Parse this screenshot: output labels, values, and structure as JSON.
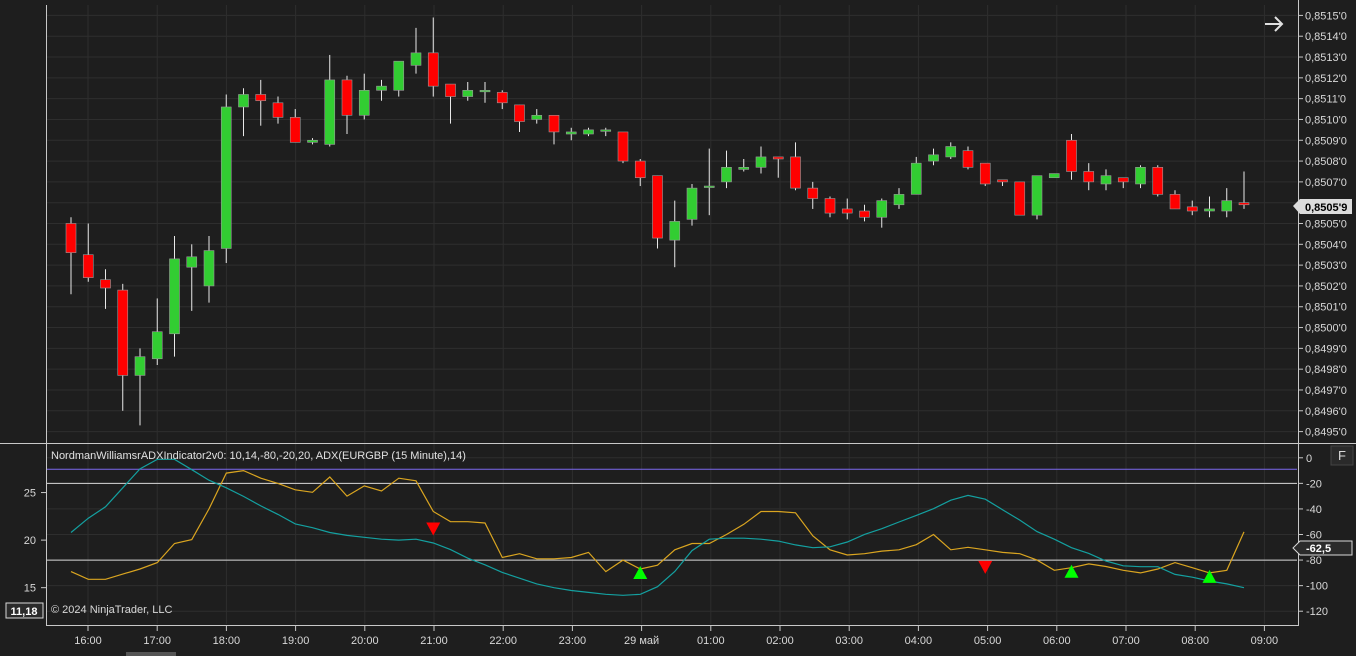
{
  "colors": {
    "background": "#1e1e1e",
    "grid": "#2e2e2e",
    "separator": "#c8c8c8",
    "up_candle": "#32cd32",
    "down_candle": "#ff0000",
    "wick": "#e8e8e8",
    "williams_line": "#daa520",
    "adx_line": "#14a0a0",
    "buy_arrow": "#00ff00",
    "sell_arrow": "#ff0000",
    "upper_level_line": "#7b68ee",
    "level_line": "#d8d8d8"
  },
  "icons": {
    "scroll_right": "arrow-right-icon",
    "panel_toggle": "F"
  },
  "indicator_title": "NordmanWilliamsrADXIndicator2v0: 10,14,-80,-20,20, ADX(EURGBP (15 Minute),14)",
  "copyright": "© 2024 NinjaTrader, LLC",
  "chart_data": [
    {
      "type": "candlestick",
      "instrument": "EURGBP (15 Minute)",
      "price_label": "0,8505'9",
      "price_tick_labels": [
        "0,8515'0",
        "0,8514'0",
        "0,8513'0",
        "0,8512'0",
        "0,8511'0",
        "0,8510'0",
        "0,8509'0",
        "0,8508'0",
        "0,8507'0",
        "0,8506'0",
        "0,8505'0",
        "0,8504'0",
        "0,8503'0",
        "0,8502'0",
        "0,8501'0",
        "0,8500'0",
        "0,8499'0",
        "0,8498'0",
        "0,8497'0",
        "0,8496'0",
        "0,8495'0"
      ],
      "y_range": [
        0.84945,
        0.85155
      ],
      "x_labels": [
        "16:00",
        "17:00",
        "18:00",
        "19:00",
        "20:00",
        "21:00",
        "22:00",
        "23:00",
        "29 май",
        "01:00",
        "02:00",
        "03:00",
        "04:00",
        "05:00",
        "06:00",
        "07:00",
        "08:00",
        "09:00"
      ],
      "candles": [
        {
          "o": 0.8505,
          "h": 0.85053,
          "l": 0.85016,
          "c": 0.85036
        },
        {
          "o": 0.85035,
          "h": 0.8505,
          "l": 0.85022,
          "c": 0.85024
        },
        {
          "o": 0.85023,
          "h": 0.85028,
          "l": 0.85009,
          "c": 0.85019
        },
        {
          "o": 0.85018,
          "h": 0.85021,
          "l": 0.8496,
          "c": 0.84977
        },
        {
          "o": 0.84977,
          "h": 0.8499,
          "l": 0.84953,
          "c": 0.84986
        },
        {
          "o": 0.84985,
          "h": 0.85014,
          "l": 0.84982,
          "c": 0.84998
        },
        {
          "o": 0.84997,
          "h": 0.85044,
          "l": 0.84986,
          "c": 0.85033
        },
        {
          "o": 0.85029,
          "h": 0.8504,
          "l": 0.85008,
          "c": 0.85034
        },
        {
          "o": 0.8502,
          "h": 0.85044,
          "l": 0.85012,
          "c": 0.85037
        },
        {
          "o": 0.85038,
          "h": 0.85112,
          "l": 0.85031,
          "c": 0.85106
        },
        {
          "o": 0.85106,
          "h": 0.85115,
          "l": 0.85092,
          "c": 0.85112
        },
        {
          "o": 0.85112,
          "h": 0.85119,
          "l": 0.85097,
          "c": 0.85109
        },
        {
          "o": 0.85108,
          "h": 0.85111,
          "l": 0.85098,
          "c": 0.85101
        },
        {
          "o": 0.85101,
          "h": 0.85105,
          "l": 0.85089,
          "c": 0.85089
        },
        {
          "o": 0.85089,
          "h": 0.85091,
          "l": 0.85088,
          "c": 0.8509
        },
        {
          "o": 0.85088,
          "h": 0.85131,
          "l": 0.85087,
          "c": 0.85119
        },
        {
          "o": 0.85119,
          "h": 0.85121,
          "l": 0.85093,
          "c": 0.85102
        },
        {
          "o": 0.85102,
          "h": 0.85122,
          "l": 0.851,
          "c": 0.85114
        },
        {
          "o": 0.85114,
          "h": 0.85119,
          "l": 0.85109,
          "c": 0.85116
        },
        {
          "o": 0.85114,
          "h": 0.85128,
          "l": 0.85111,
          "c": 0.85128
        },
        {
          "o": 0.85126,
          "h": 0.85144,
          "l": 0.85122,
          "c": 0.85132
        },
        {
          "o": 0.85132,
          "h": 0.85149,
          "l": 0.85111,
          "c": 0.85116
        },
        {
          "o": 0.85117,
          "h": 0.85117,
          "l": 0.85098,
          "c": 0.85111
        },
        {
          "o": 0.85111,
          "h": 0.85118,
          "l": 0.85109,
          "c": 0.85114
        },
        {
          "o": 0.85114,
          "h": 0.85118,
          "l": 0.85108,
          "c": 0.85114
        },
        {
          "o": 0.85113,
          "h": 0.85114,
          "l": 0.85105,
          "c": 0.85108
        },
        {
          "o": 0.85107,
          "h": 0.85103,
          "l": 0.85094,
          "c": 0.85099
        },
        {
          "o": 0.851,
          "h": 0.85105,
          "l": 0.85098,
          "c": 0.85102
        },
        {
          "o": 0.85102,
          "h": 0.85102,
          "l": 0.85088,
          "c": 0.85094
        },
        {
          "o": 0.85093,
          "h": 0.85096,
          "l": 0.8509,
          "c": 0.85094
        },
        {
          "o": 0.85093,
          "h": 0.85096,
          "l": 0.85092,
          "c": 0.85095
        },
        {
          "o": 0.85095,
          "h": 0.85096,
          "l": 0.85092,
          "c": 0.85095
        },
        {
          "o": 0.85094,
          "h": 0.85094,
          "l": 0.85079,
          "c": 0.8508
        },
        {
          "o": 0.8508,
          "h": 0.85081,
          "l": 0.85068,
          "c": 0.85072
        },
        {
          "o": 0.85073,
          "h": 0.85071,
          "l": 0.85038,
          "c": 0.85043
        },
        {
          "o": 0.85042,
          "h": 0.85061,
          "l": 0.85029,
          "c": 0.85051
        },
        {
          "o": 0.85052,
          "h": 0.85069,
          "l": 0.85049,
          "c": 0.85067
        },
        {
          "o": 0.85068,
          "h": 0.85086,
          "l": 0.85054,
          "c": 0.85068
        },
        {
          "o": 0.8507,
          "h": 0.85085,
          "l": 0.85067,
          "c": 0.85077
        },
        {
          "o": 0.85076,
          "h": 0.85081,
          "l": 0.85075,
          "c": 0.85077
        },
        {
          "o": 0.85077,
          "h": 0.85087,
          "l": 0.85074,
          "c": 0.85082
        },
        {
          "o": 0.85082,
          "h": 0.85082,
          "l": 0.85072,
          "c": 0.85081
        },
        {
          "o": 0.85082,
          "h": 0.85089,
          "l": 0.85066,
          "c": 0.85067
        },
        {
          "o": 0.85067,
          "h": 0.8507,
          "l": 0.85057,
          "c": 0.85062
        },
        {
          "o": 0.85062,
          "h": 0.85063,
          "l": 0.85053,
          "c": 0.85055
        },
        {
          "o": 0.85057,
          "h": 0.85062,
          "l": 0.85052,
          "c": 0.85055
        },
        {
          "o": 0.85056,
          "h": 0.85059,
          "l": 0.85051,
          "c": 0.85053
        },
        {
          "o": 0.85053,
          "h": 0.85062,
          "l": 0.85048,
          "c": 0.85061
        },
        {
          "o": 0.85059,
          "h": 0.85067,
          "l": 0.85057,
          "c": 0.85064
        },
        {
          "o": 0.85064,
          "h": 0.85082,
          "l": 0.85064,
          "c": 0.85079
        },
        {
          "o": 0.8508,
          "h": 0.85086,
          "l": 0.85078,
          "c": 0.85083
        },
        {
          "o": 0.85082,
          "h": 0.85089,
          "l": 0.85081,
          "c": 0.85087
        },
        {
          "o": 0.85085,
          "h": 0.85087,
          "l": 0.85076,
          "c": 0.85077
        },
        {
          "o": 0.85079,
          "h": 0.85078,
          "l": 0.85068,
          "c": 0.85069
        },
        {
          "o": 0.85071,
          "h": 0.8507,
          "l": 0.85068,
          "c": 0.8507
        },
        {
          "o": 0.8507,
          "h": 0.85068,
          "l": 0.85055,
          "c": 0.85054
        },
        {
          "o": 0.85054,
          "h": 0.85072,
          "l": 0.85052,
          "c": 0.85073
        },
        {
          "o": 0.85072,
          "h": 0.85074,
          "l": 0.85072,
          "c": 0.85074
        },
        {
          "o": 0.8509,
          "h": 0.85093,
          "l": 0.85071,
          "c": 0.85075
        },
        {
          "o": 0.85075,
          "h": 0.85079,
          "l": 0.85066,
          "c": 0.8507
        },
        {
          "o": 0.85069,
          "h": 0.85076,
          "l": 0.85066,
          "c": 0.85073
        },
        {
          "o": 0.85072,
          "h": 0.85072,
          "l": 0.85067,
          "c": 0.8507
        },
        {
          "o": 0.85069,
          "h": 0.85078,
          "l": 0.85067,
          "c": 0.85077
        },
        {
          "o": 0.85077,
          "h": 0.85078,
          "l": 0.85063,
          "c": 0.85064
        },
        {
          "o": 0.85064,
          "h": 0.85066,
          "l": 0.85057,
          "c": 0.85057
        },
        {
          "o": 0.85058,
          "h": 0.85061,
          "l": 0.85054,
          "c": 0.85056
        },
        {
          "o": 0.85056,
          "h": 0.85063,
          "l": 0.85053,
          "c": 0.85057
        },
        {
          "o": 0.85056,
          "h": 0.85067,
          "l": 0.85053,
          "c": 0.85061
        },
        {
          "o": 0.8506,
          "h": 0.85075,
          "l": 0.85057,
          "c": 0.85059
        }
      ]
    },
    {
      "type": "line",
      "panel": "indicator",
      "left_axis_ticks": [
        "25",
        "20",
        "15"
      ],
      "left_axis_range": [
        11.18,
        30
      ],
      "right_axis_ticks": [
        "0",
        "-20",
        "-40",
        "-60",
        "-80",
        "-100",
        "-120"
      ],
      "right_axis_range": [
        -130,
        10
      ],
      "levels": [
        {
          "value": -20,
          "style": "white"
        },
        {
          "value": -80,
          "style": "white"
        },
        {
          "value": -9,
          "style": "purple"
        }
      ],
      "value_tags": {
        "right": "-62,5",
        "left": "11,18"
      },
      "series": [
        {
          "axis": "right",
          "values": [
            -89,
            -95,
            -95,
            -91,
            -87,
            -82,
            -67,
            -64,
            -40,
            -12,
            -10,
            -16,
            -20,
            -25,
            -27,
            -15,
            -30,
            -22,
            -26,
            -16,
            -18,
            -42,
            -50,
            -50,
            -51,
            -78,
            -75,
            -79,
            -79,
            -78,
            -74,
            -89,
            -80,
            -87,
            -84,
            -72,
            -67,
            -67,
            -60,
            -52,
            -42,
            -42,
            -43,
            -61,
            -72,
            -76,
            -75,
            -73,
            -72,
            -68,
            -60,
            -72,
            -70,
            -72,
            -74,
            -75,
            -80,
            -88,
            -86,
            -83,
            -85,
            -88,
            -90,
            -87,
            -82,
            -86,
            -90,
            -88,
            -58
          ]
        },
        {
          "axis": "left",
          "values": [
            20.8,
            22.3,
            23.5,
            25.5,
            27.5,
            28.5,
            28.5,
            27.4,
            26.3,
            25.5,
            24.6,
            23.6,
            22.7,
            21.7,
            21.3,
            20.8,
            20.5,
            20.3,
            20.1,
            20.0,
            20.1,
            19.7,
            19.0,
            18.1,
            17.4,
            16.6,
            16.0,
            15.4,
            15.0,
            14.7,
            14.5,
            14.3,
            14.2,
            14.3,
            15.1,
            16.7,
            18.9,
            20.1,
            20.2,
            20.2,
            20.1,
            19.9,
            19.5,
            19.2,
            19.3,
            19.8,
            20.6,
            21.2,
            21.9,
            22.6,
            23.3,
            24.2,
            24.7,
            24.3,
            23.2,
            22.1,
            20.9,
            20.1,
            19.2,
            18.6,
            17.8,
            17.3,
            17.2,
            17.2,
            16.4,
            16.1,
            15.7,
            15.4,
            15.0
          ]
        }
      ],
      "signals": [
        {
          "type": "sell",
          "index": 21
        },
        {
          "type": "buy",
          "index": 33
        },
        {
          "type": "sell",
          "index": 53
        },
        {
          "type": "buy",
          "index": 58
        },
        {
          "type": "buy",
          "index": 66
        }
      ]
    }
  ]
}
